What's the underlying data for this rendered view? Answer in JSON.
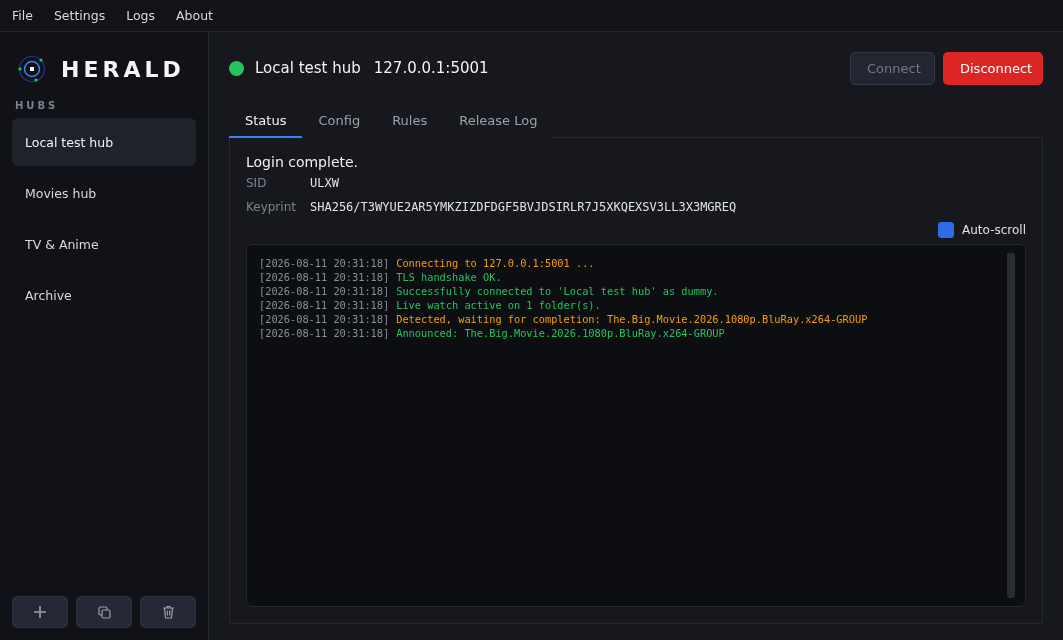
{
  "menu": [
    "File",
    "Settings",
    "Logs",
    "About"
  ],
  "sidebar": {
    "brand": "HERALD",
    "section": "HUBS",
    "hubs": [
      {
        "label": "Local test hub",
        "selected": true
      },
      {
        "label": "Movies hub",
        "selected": false
      },
      {
        "label": "TV & Anime",
        "selected": false
      },
      {
        "label": "Archive",
        "selected": false
      }
    ]
  },
  "header": {
    "color": "#22c55e",
    "name": "Local test hub",
    "address": "127.0.0.1:5001",
    "buttons": [
      {
        "label": "Connect",
        "kind": "secondary",
        "disabled": true
      },
      {
        "label": "Disconnect",
        "kind": "danger",
        "disabled": false
      }
    ]
  },
  "tabs": [
    {
      "label": "Status",
      "selected": true
    },
    {
      "label": "Config",
      "selected": false
    },
    {
      "label": "Rules",
      "selected": false
    },
    {
      "label": "Release Log",
      "selected": false
    }
  ],
  "status": {
    "message": "Login complete.",
    "fields": [
      {
        "label": "SID",
        "value": "ULXW"
      },
      {
        "label": "Keyprint",
        "value": "SHA256/T3WYUE2AR5YMKZIZDFDGF5BVJDSIRLR7J5XKQEXSV3LL3X3MGREQ"
      }
    ],
    "auto_scroll": {
      "label": "Auto-scroll",
      "checked": true
    },
    "log": [
      {
        "time": "[2026-08-11 20:31:18]",
        "color": "#f59e0b",
        "text": "Connecting to 127.0.0.1:5001 ..."
      },
      {
        "time": "[2026-08-11 20:31:18]",
        "color": "#22c55e",
        "text": "TLS handshake OK."
      },
      {
        "time": "[2026-08-11 20:31:18]",
        "color": "#22c55e",
        "text": "Successfully connected to 'Local test hub' as dummy."
      },
      {
        "time": "[2026-08-11 20:31:18]",
        "color": "#22c55e",
        "text": "Live watch active on 1 folder(s)."
      },
      {
        "time": "[2026-08-11 20:31:18]",
        "color": "#f59e0b",
        "text": "Detected, waiting for completion: The.Big.Movie.2026.1080p.BluRay.x264-GROUP"
      },
      {
        "time": "[2026-08-11 20:31:18]",
        "color": "#22c55e",
        "text": "Announced: The.Big.Movie.2026.1080p.BluRay.x264-GROUP"
      }
    ]
  }
}
